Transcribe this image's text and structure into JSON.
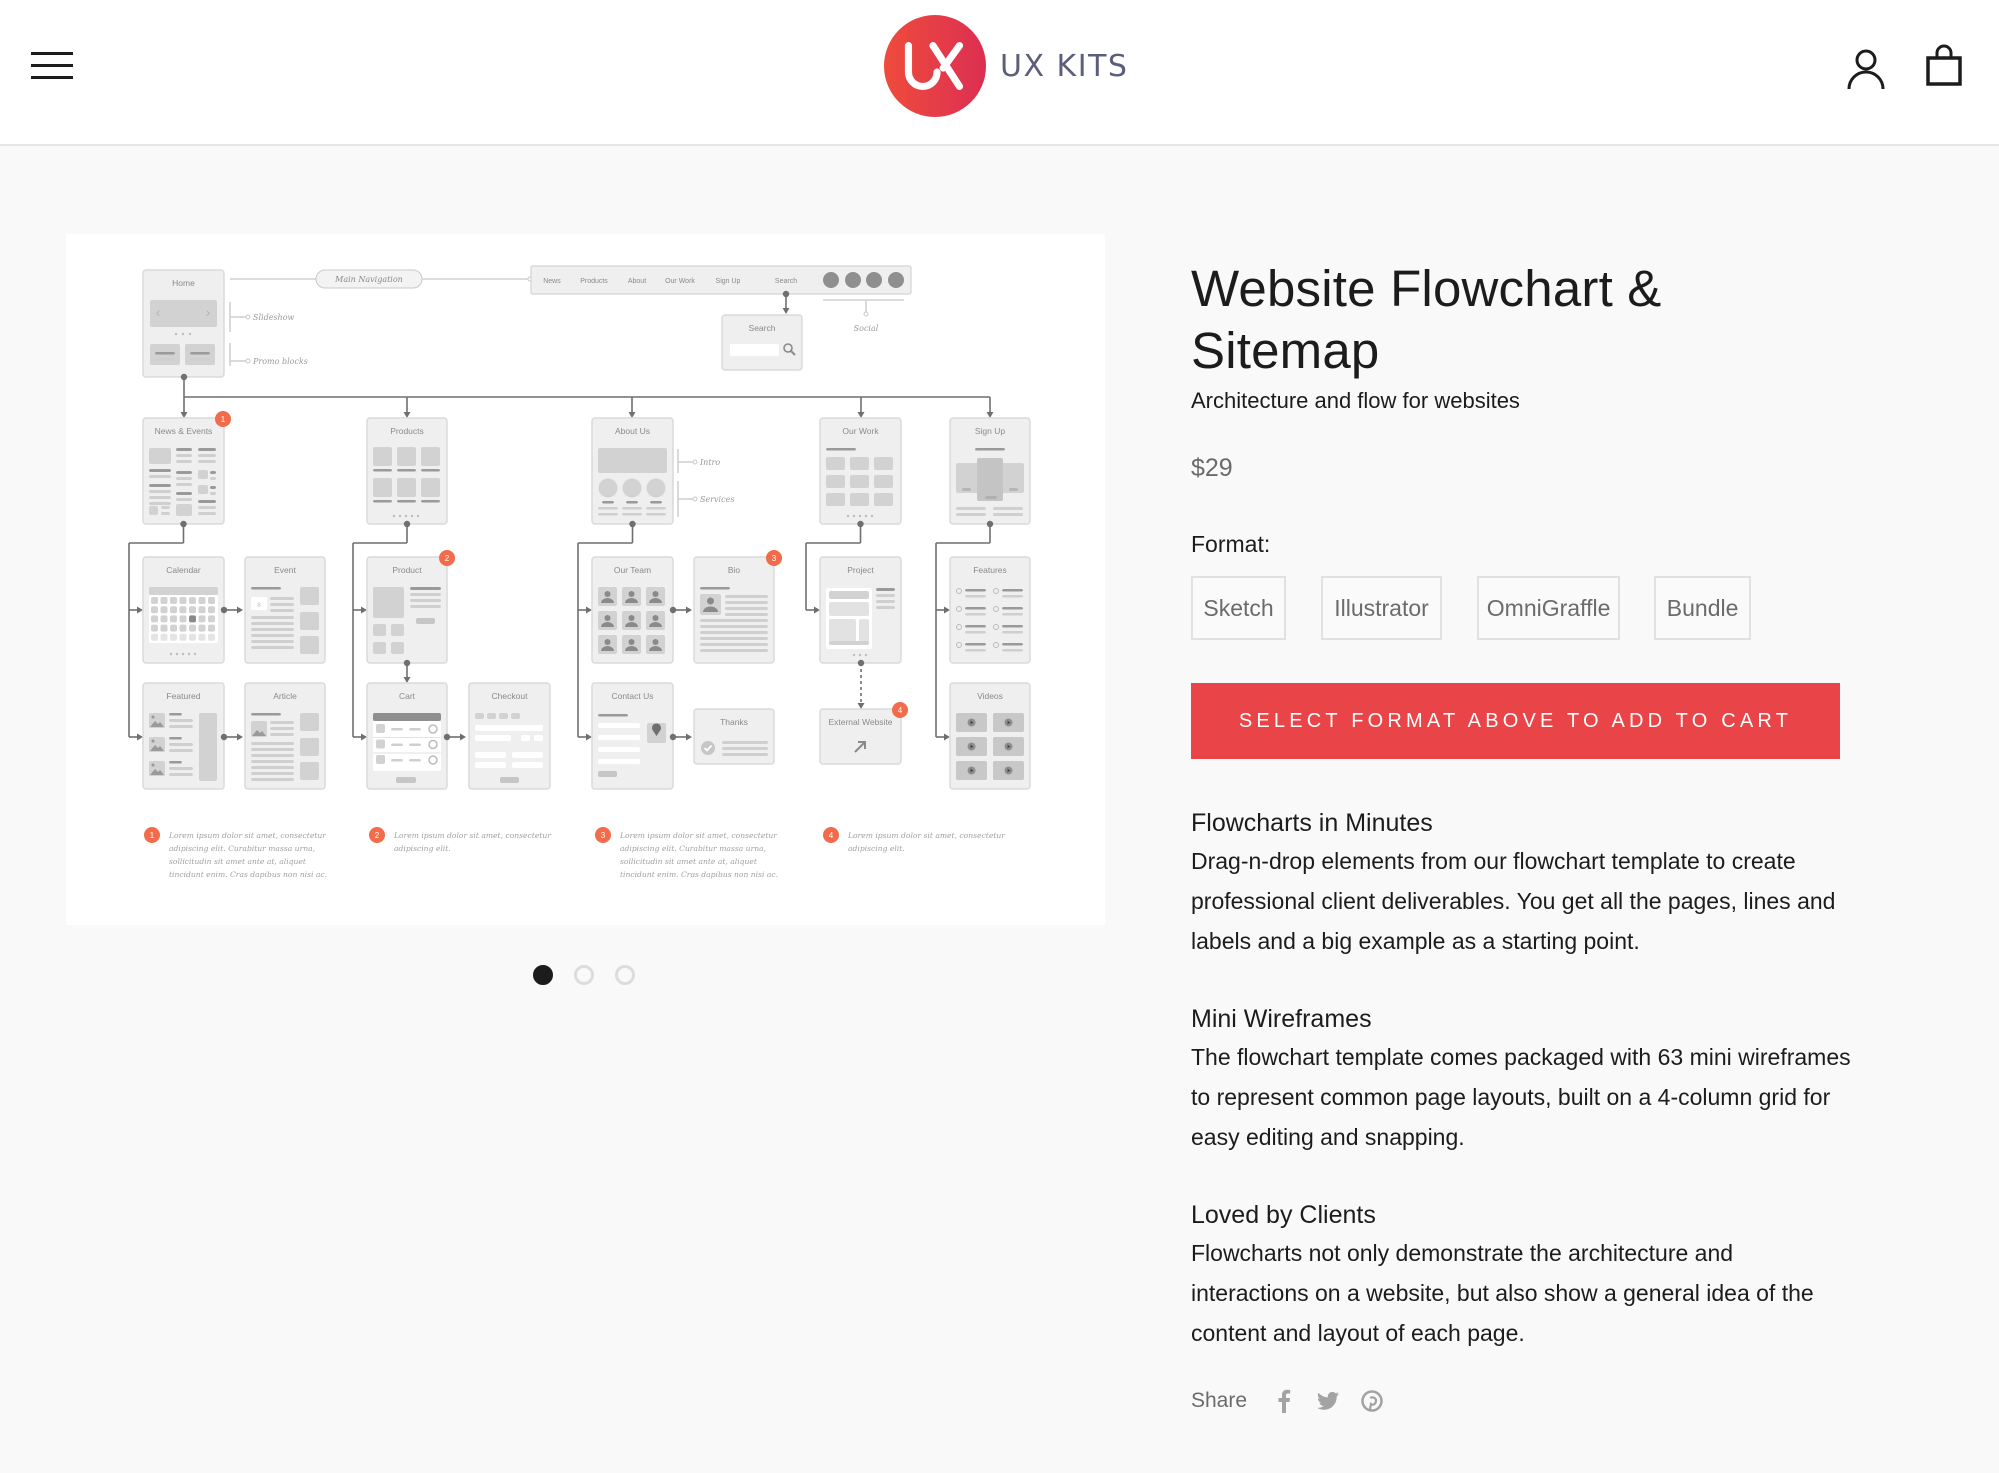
{
  "header": {
    "menu_icon": "hamburger-icon",
    "logo_text": "UX KITS",
    "logo_mark": "UX",
    "account_icon": "user-icon",
    "cart_icon": "shopping-bag-icon",
    "brand_color": "#e94447"
  },
  "gallery": {
    "slides": 3,
    "active_slide": 1,
    "image": {
      "nav_label": "Main Navigation",
      "nav_items": [
        "News",
        "Products",
        "About",
        "Our Work",
        "Sign Up",
        "Search"
      ],
      "annotations": {
        "slideshow": "Slideshow",
        "promo": "Promo blocks",
        "social": "Social",
        "intro": "Intro",
        "services": "Services"
      },
      "search_card": "Search",
      "cards": {
        "home": "Home",
        "news": "News & Events",
        "products": "Products",
        "about": "About Us",
        "ourwork": "Our Work",
        "signup": "Sign Up",
        "calendar": "Calendar",
        "event": "Event",
        "product": "Product",
        "ourteam": "Our Team",
        "bio": "Bio",
        "project": "Project",
        "features": "Features",
        "featured": "Featured",
        "article": "Article",
        "cart": "Cart",
        "checkout": "Checkout",
        "contact": "Contact Us",
        "thanks": "Thanks",
        "external": "External Website",
        "videos": "Videos"
      },
      "badges": [
        "1",
        "2",
        "3",
        "4"
      ],
      "notes": [
        {
          "num": "1",
          "lines": [
            "Lorem ipsum dolor sit amet, consectetur",
            "adipiscing elit. Curabitur massa urna,",
            "sollicitudin sit amet ante at, aliquet",
            "tincidunt enim. Cras dapibus non nisi ac."
          ]
        },
        {
          "num": "2",
          "lines": [
            "Lorem ipsum dolor sit amet, consectetur",
            "adipiscing elit."
          ]
        },
        {
          "num": "3",
          "lines": [
            "Lorem ipsum dolor sit amet, consectetur",
            "adipiscing elit. Curabitur massa urna,",
            "sollicitudin sit amet ante at, aliquet",
            "tincidunt enim. Cras dapibus non nisi ac."
          ]
        },
        {
          "num": "4",
          "lines": [
            "Lorem ipsum dolor sit amet, consectetur",
            "adipiscing elit."
          ]
        }
      ]
    }
  },
  "product": {
    "title": "Website Flowchart & Sitemap",
    "subtitle": "Architecture and flow for websites",
    "price": "$29",
    "format_label": "Format:",
    "formats": [
      "Sketch",
      "Illustrator",
      "OmniGraffle",
      "Bundle"
    ],
    "cta_label": "SELECT FORMAT ABOVE TO ADD TO CART",
    "sections": [
      {
        "title": "Flowcharts in Minutes",
        "body": "Drag-n-drop elements from our flowchart template to create professional client deliverables. You get all the pages, lines and labels and a big example as a starting point."
      },
      {
        "title": "Mini Wireframes",
        "body": "The flowchart template comes packaged with 63 mini wireframes to represent common page layouts, built on a 4-column grid for easy editing and snapping."
      },
      {
        "title": "Loved by Clients",
        "body": "Flowcharts not only demonstrate the architecture and interactions on a website, but also show a general idea of the content and layout of each page."
      }
    ],
    "share_label": "Share",
    "share_icons": [
      "facebook-icon",
      "twitter-icon",
      "pinterest-icon"
    ]
  }
}
